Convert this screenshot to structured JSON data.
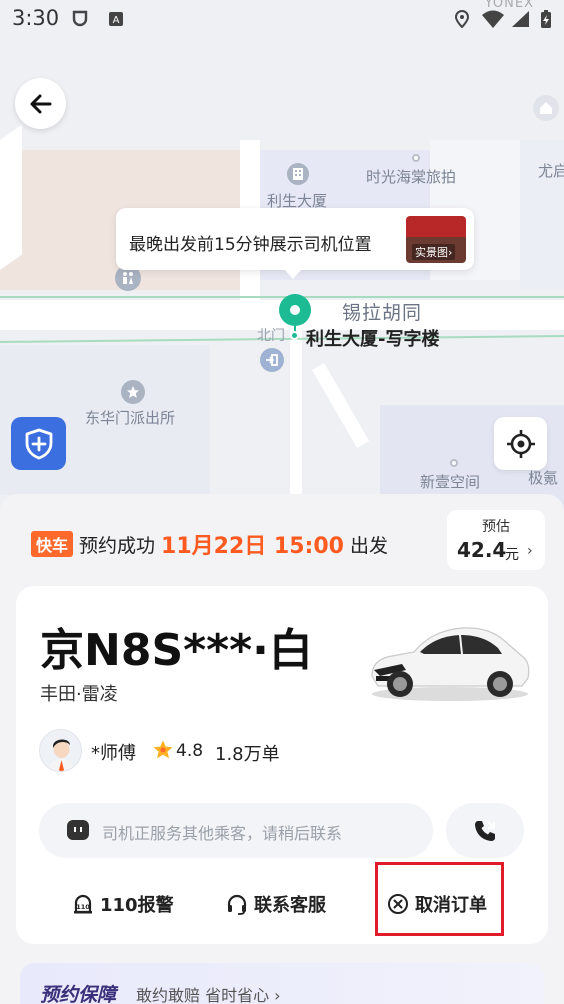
{
  "status_bar": {
    "time": "3:30",
    "brand": "YONEX"
  },
  "map": {
    "tooltip_text": "最晚出发前15分钟展示司机位置",
    "tooltip_photo_label": "实景图›",
    "pois": {
      "lisheng": "利生大厦",
      "hotel": "时光海棠旅拍",
      "youqi": "尤启",
      "police": "东华门派出所",
      "xinyi": "新壹空间",
      "jiqi": "极氪"
    },
    "street": "锡拉胡同",
    "pin_label": "利生大厦-写字楼",
    "north_gate": "北门"
  },
  "order": {
    "tag": "快车",
    "status": "预约成功",
    "date_time": "11月22日 15:00",
    "suffix": "出发",
    "price_label": "预估",
    "price_value": "42.4",
    "price_unit": "元"
  },
  "vehicle": {
    "plate": "京N8S***·白",
    "model": "丰田·雷凌"
  },
  "driver": {
    "name": "*师傅",
    "rating": "4.8",
    "orders": "1.8万单"
  },
  "message": {
    "placeholder": "司机正服务其他乘客，请稍后联系"
  },
  "actions": {
    "police": "110报警",
    "service": "联系客服",
    "cancel": "取消订单"
  },
  "guarantee": {
    "title": "预约保障",
    "subtitle": "敢约敢赔 省时省心"
  },
  "colors": {
    "accent_orange": "#ff5a1f",
    "pin_green": "#1dbb93",
    "shield_blue": "#3b6fe0",
    "highlight_red": "#e11b2a"
  }
}
